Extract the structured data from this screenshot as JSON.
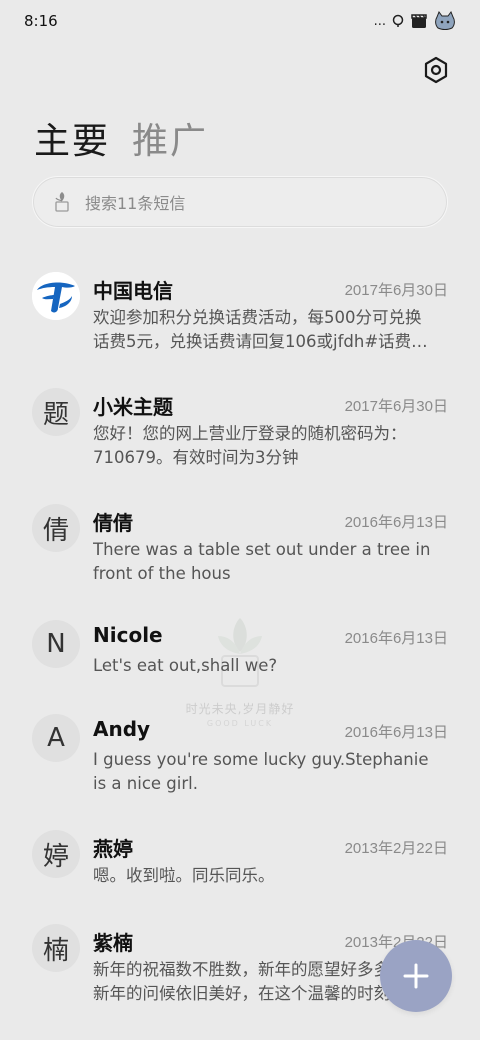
{
  "status_bar": {
    "time": "8:16",
    "icons": [
      "dots-icon",
      "alarm-icon",
      "clapper-icon",
      "cat-icon"
    ],
    "dots_text": "..."
  },
  "header": {
    "tabs": [
      {
        "label": "主要",
        "active": true
      },
      {
        "label": "推广",
        "active": false
      }
    ]
  },
  "search": {
    "placeholder": "搜索11条短信"
  },
  "messages": [
    {
      "name": "中国电信",
      "date": "2017年6月30日",
      "avatar": "",
      "avatar_type": "china-telecom-logo",
      "preview": [
        "欢迎参加积分兑换话费活动，每500分可兑换",
        "话费5元，兑换话费请回复106或jfdh#话费…"
      ]
    },
    {
      "name": "小米主题",
      "date": "2017年6月30日",
      "avatar": "题",
      "preview": [
        "您好！您的网上营业厅登录的随机密码为：",
        "710679。有效时间为3分钟"
      ]
    },
    {
      "name": "倩倩",
      "date": "2016年6月13日",
      "avatar": "倩",
      "preview": [
        "There was a table set out under a tree in",
        "front of the hous"
      ]
    },
    {
      "name": "Nicole",
      "date": "2016年6月13日",
      "avatar": "N",
      "preview": [
        "Let's eat out,shall we?"
      ]
    },
    {
      "name": "Andy",
      "date": "2016年6月13日",
      "avatar": "A",
      "preview": [
        "I guess you're some lucky guy.Stephanie",
        "is a nice girl."
      ]
    },
    {
      "name": "燕婷",
      "date": "2013年2月22日",
      "avatar": "婷",
      "preview": [
        "嗯。收到啦。同乐同乐。"
      ]
    },
    {
      "name": "紫楠",
      "date": "2013年2月22日",
      "avatar": "楠",
      "preview": [
        "新年的祝福数不胜数，新年的愿望好多多，",
        "新年的问候依旧美好，在这个温馨的时刻…"
      ]
    }
  ],
  "watermark": {
    "line1": "时光未央,岁月静好",
    "line2": "GOOD LUCK"
  },
  "fab": {
    "icon": "plus-icon",
    "color": "#9aa3c4"
  },
  "colors": {
    "background": "#eaeaea",
    "accent": "#9aa3c4",
    "telecom_blue": "#1565c0"
  }
}
